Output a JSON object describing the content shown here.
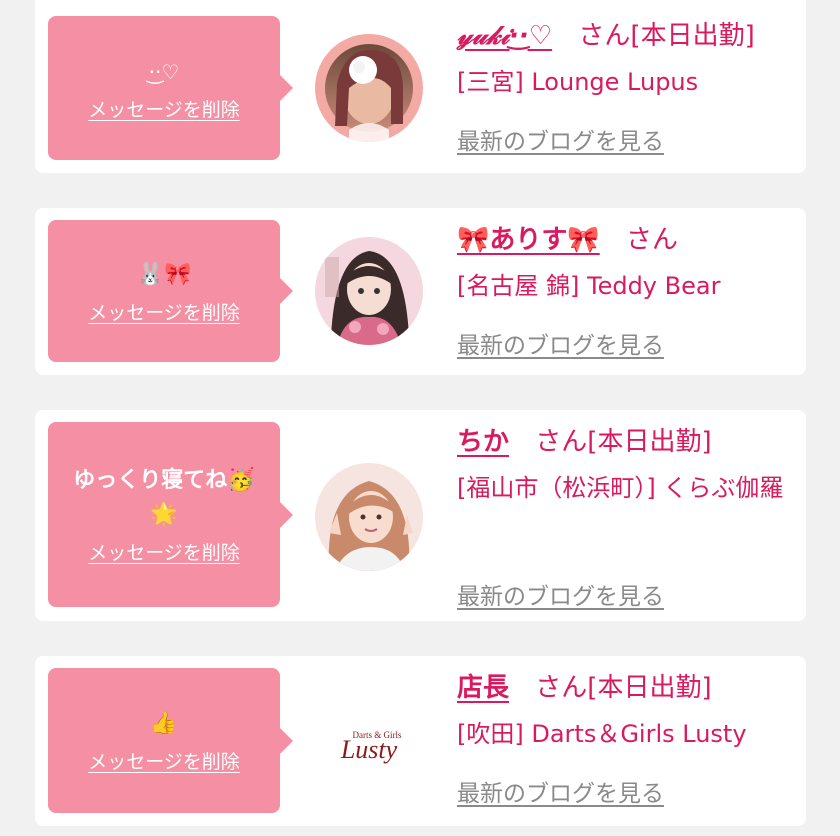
{
  "cards": [
    {
      "message": "·͜·♡",
      "delete_label": "メッセージを削除",
      "name": "𝓎𝓊𝓀𝒾·͜·♡",
      "honorific": "さん",
      "status": "[本日出勤]",
      "shop": "[三宮] Lounge Lupus",
      "blog_label": "最新のブログを見る",
      "avatar_icon": "profile-photo"
    },
    {
      "message": "🐰🎀",
      "delete_label": "メッセージを削除",
      "name": "🎀ありす🎀",
      "honorific": "さん",
      "status": "",
      "shop": "[名古屋 錦] Teddy Bear",
      "blog_label": "最新のブログを見る",
      "avatar_icon": "profile-photo"
    },
    {
      "message": "ゆっくり寝てね🥳🌟",
      "delete_label": "メッセージを削除",
      "name": "ちか",
      "honorific": "さん",
      "status": "[本日出勤]",
      "shop": "[福山市（松浜町）] くらぶ伽羅",
      "blog_label": "最新のブログを見る",
      "avatar_icon": "profile-photo"
    },
    {
      "message": "👍",
      "delete_label": "メッセージを削除",
      "name": "店長",
      "honorific": "さん",
      "status": "[本日出勤]",
      "shop": "[吹田] Darts＆Girls Lusty",
      "blog_label": "最新のブログを見る",
      "avatar_icon": "shop-logo",
      "logo_small": "Darts & Girls",
      "logo_big": "Lusty"
    }
  ],
  "colors": {
    "accent": "#d81b60",
    "bubble": "#f58fa3",
    "muted": "#8a8a8a"
  }
}
